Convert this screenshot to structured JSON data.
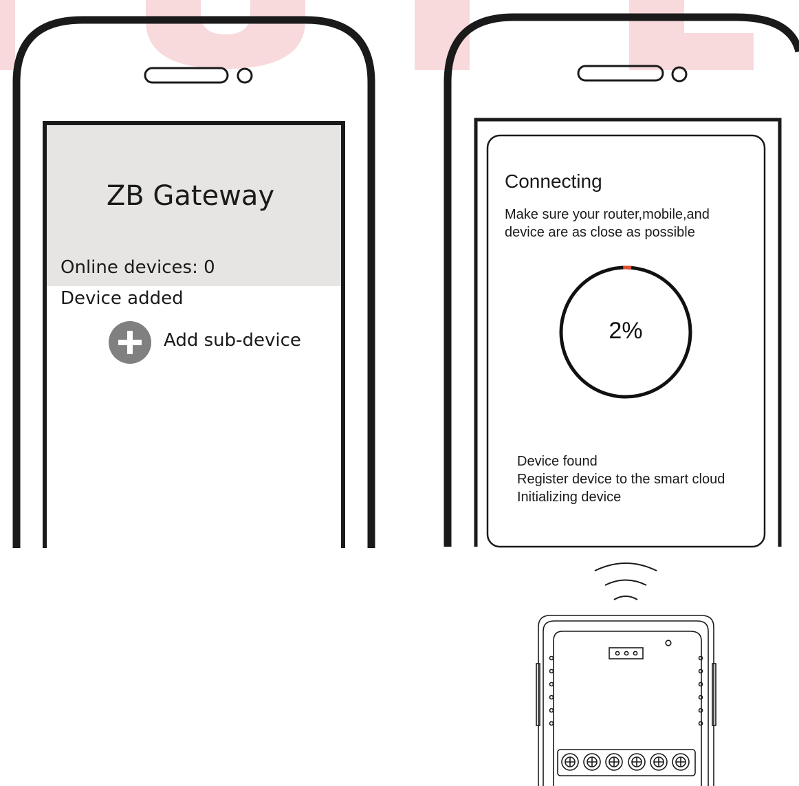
{
  "colors": {
    "watermark": "#f8d9dc",
    "outline": "#1a1a1a",
    "header_bg": "#e6e5e3",
    "plus_circle": "#808080",
    "progress_accent": "#e05030"
  },
  "left_phone": {
    "title": "ZB Gateway",
    "online_devices": "Online devices: 0",
    "device_added": "Device added",
    "add_sub_device": {
      "icon": "plus-circle-icon",
      "label": "Add sub-device"
    }
  },
  "right_phone": {
    "heading": "Connecting",
    "message": "Make sure your router,mobile,and device are as close as possible",
    "progress": {
      "percent_label": "2%",
      "fraction": 0.02
    },
    "steps": [
      "Device found",
      "Register device to the smart cloud",
      "Initializing device"
    ]
  },
  "device": {
    "icon": "smart-switch-module-icon",
    "signal_icon": "wifi-signal-icon"
  }
}
